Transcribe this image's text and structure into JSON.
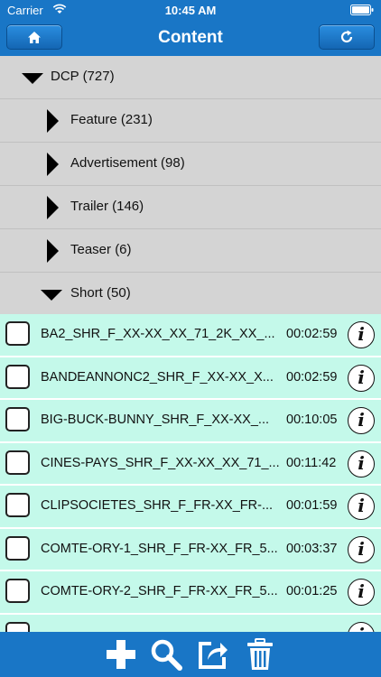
{
  "status_bar": {
    "carrier": "Carrier",
    "time": "10:45 AM"
  },
  "nav": {
    "title": "Content",
    "left_icon": "home-icon",
    "right_icon": "refresh-icon"
  },
  "tree": [
    {
      "label": "DCP (727)",
      "expanded": true,
      "level": 0
    },
    {
      "label": "Feature (231)",
      "expanded": false,
      "level": 1
    },
    {
      "label": "Advertisement (98)",
      "expanded": false,
      "level": 1
    },
    {
      "label": "Trailer (146)",
      "expanded": false,
      "level": 1
    },
    {
      "label": "Teaser (6)",
      "expanded": false,
      "level": 1
    },
    {
      "label": "Short (50)",
      "expanded": true,
      "level": 1
    }
  ],
  "items": [
    {
      "name": "BA2_SHR_F_XX-XX_XX_71_2K_XX_...",
      "duration": "00:02:59"
    },
    {
      "name": "BANDEANNONC2_SHR_F_XX-XX_X...",
      "duration": "00:02:59"
    },
    {
      "name": "BIG-BUCK-BUNNY_SHR_F_XX-XX_...",
      "duration": "00:10:05"
    },
    {
      "name": "CINES-PAYS_SHR_F_XX-XX_XX_71_...",
      "duration": "00:11:42"
    },
    {
      "name": "CLIPSOCIETES_SHR_F_FR-XX_FR-...",
      "duration": "00:01:59"
    },
    {
      "name": "COMTE-ORY-1_SHR_F_FR-XX_FR_5...",
      "duration": "00:03:37"
    },
    {
      "name": "COMTE-ORY-2_SHR_F_FR-XX_FR_5...",
      "duration": "00:01:25"
    },
    {
      "name": "",
      "duration": ""
    }
  ],
  "toolbar": {
    "icons": [
      "add-icon",
      "search-icon",
      "share-icon",
      "trash-icon"
    ]
  },
  "colors": {
    "bar": "#1976c6",
    "tree_bg": "#d4d4d4",
    "item_bg": "#c4f9ea"
  }
}
